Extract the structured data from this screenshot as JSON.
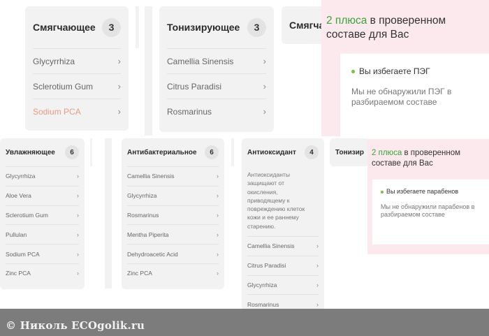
{
  "cards_top": [
    {
      "title": "Смягчающее",
      "count": "3",
      "items": [
        {
          "label": "Glycyrrhiza",
          "chevron": "›"
        },
        {
          "label": "Sclerotium Gum",
          "chevron": "›"
        },
        {
          "label": "Sodium PCA",
          "chevron": "›"
        }
      ]
    },
    {
      "title": "Тонизирующее",
      "count": "3",
      "items": [
        {
          "label": "Camellia Sinensis",
          "chevron": "›"
        },
        {
          "label": "Citrus Paradisi",
          "chevron": "›"
        },
        {
          "label": "Rosmarinus",
          "chevron": "›"
        }
      ]
    },
    {
      "title": "Смягча"
    }
  ],
  "cards_small": [
    {
      "title": "Увлажняющее",
      "count": "6",
      "items": [
        {
          "label": "Glycyrrhiza",
          "chevron": "›"
        },
        {
          "label": "Aloe Vera",
          "chevron": "›"
        },
        {
          "label": "Sclerotium Gum",
          "chevron": "›"
        },
        {
          "label": "Pullulan",
          "chevron": "›"
        },
        {
          "label": "Sodium PCA",
          "chevron": "›"
        },
        {
          "label": "Zinc PCA",
          "chevron": "›"
        }
      ]
    },
    {
      "title": "Антибактериальное",
      "count": "6",
      "items": [
        {
          "label": "Camellia Sinensis",
          "chevron": "›"
        },
        {
          "label": "Glycyrrhiza",
          "chevron": "›"
        },
        {
          "label": "Rosmarinus",
          "chevron": "›"
        },
        {
          "label": "Mentha Piperita",
          "chevron": "›"
        },
        {
          "label": "Dehydroacetic Acid",
          "chevron": "›"
        },
        {
          "label": "Zinc PCA",
          "chevron": "›"
        }
      ]
    },
    {
      "title": "Антиоксидант",
      "count": "4",
      "description": "Антиоксиданты защищают от окисления, приводящему к повреждению клеток кожи и ее раннему старению.",
      "items": [
        {
          "label": "Camellia Sinensis",
          "chevron": "›"
        },
        {
          "label": "Citrus Paradisi",
          "chevron": "›"
        },
        {
          "label": "Glycyrrhiza",
          "chevron": "›"
        },
        {
          "label": "Rosmarinus",
          "chevron": "›"
        }
      ]
    },
    {
      "title": "Тонизир"
    }
  ],
  "panel_top": {
    "count": "2 плюса",
    "rest": " в проверенном составе для Вас",
    "bullet_title": "Вы избегаете ПЭГ",
    "bullet_text": "Мы не обнаружили ПЭГ в разбираемом составе"
  },
  "panel_bottom": {
    "count": "2 плюса",
    "rest": " в проверенном составе для Вас",
    "bullet_title": "Вы избегаете парабенов",
    "bullet_text": "Мы не обнаружили парабенов в разбираемом составе"
  },
  "watermark": "© Николь ECOgolik.ru",
  "colors": {
    "card_bg": "#f2f2f2",
    "pink_bg": "#fbe9ee",
    "accent_green": "#3aa33a",
    "highlight_orange": "#e79c80"
  }
}
